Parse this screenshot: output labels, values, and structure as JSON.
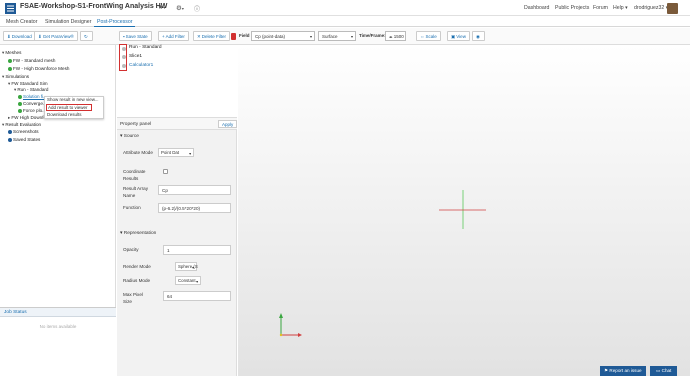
{
  "header": {
    "title": "FSAE-Workshop-S1-FrontWing Analysis HW",
    "nav": [
      "Dashboard",
      "Public Projects",
      "Forum",
      "Help"
    ],
    "username": "drodriguez32"
  },
  "tabs": [
    {
      "label": "Mesh Creator"
    },
    {
      "label": "Simulation Designer"
    },
    {
      "label": "Post-Processor"
    }
  ],
  "toolbar": {
    "download": "Download",
    "paraview": "Get ParaView®",
    "save_state": "Save State",
    "add_filter": "Add Filter",
    "delete_filter": "Delete Filter",
    "field_label": "Field",
    "field_value": "Cp (point-data)",
    "representation_value": "Surface",
    "time_label": "Time/Frame:",
    "time_value": "1500",
    "scale": "Scale",
    "view": "View"
  },
  "tree": {
    "meshes": "Meshes",
    "mesh1": "FW - Standard mesh",
    "mesh2": "FW - High Downforce Mesh",
    "simulations": "Simulations",
    "sim1": "FW Standard Sim",
    "run": "Run - Standard",
    "solution": "Solution fi...",
    "convergence": "Converge...",
    "force": "Force plo...",
    "sim2": "FW High Downforce sim",
    "result_eval": "Result Evaluation",
    "screenshots": "Screenshots",
    "saved_states": "Saved States"
  },
  "context_menu": {
    "item1": "Show result in new view...",
    "item2": "Add result to viewer",
    "item3": "Download results"
  },
  "job_status": {
    "title": "Job Status",
    "empty": "No items available"
  },
  "pipeline": {
    "items": [
      "Run - Standard",
      "Slice1",
      "Calculator1"
    ]
  },
  "property_panel": {
    "title": "Property panel",
    "apply": "Apply",
    "source": "Source",
    "attribute_mode_label": "Attribute Mode",
    "attribute_mode_value": "Point Dat",
    "coordinate_results_label": "Coordinate Results",
    "result_array_label": "Result Array Name",
    "result_array_value": "Cp",
    "function_label": "Function",
    "function_value": "(p-6.2)/(0.5*20*20)",
    "representation": "Representation",
    "opacity_label": "Opacity",
    "opacity_value": "1",
    "render_mode_label": "Render Mode",
    "render_mode_value": "Sphere (S",
    "radius_mode_label": "Radius Mode",
    "radius_mode_value": "Constant",
    "max_pixel_label": "Max Pixel Size",
    "max_pixel_value": "64"
  },
  "footer": {
    "report": "Report an issue",
    "chat": "Chat"
  },
  "colors": {
    "accent": "#1a6fb0",
    "highlight": "#d23030",
    "status_green": "#3aa640",
    "dark_blue": "#1f5a96"
  }
}
